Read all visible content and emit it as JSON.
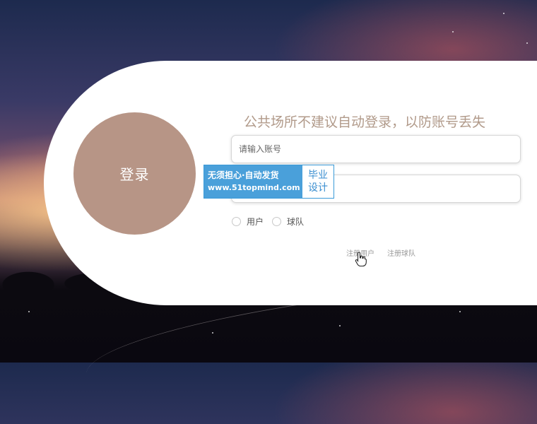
{
  "login": {
    "circle_label": "登录",
    "notice": "公共场所不建议自动登录，以防账号丢失",
    "username_placeholder": "请输入账号",
    "password_placeholder": "",
    "roles": [
      {
        "label": "用户"
      },
      {
        "label": "球队"
      }
    ],
    "links": {
      "register_user": "注册用户",
      "register_team": "注册球队"
    }
  },
  "watermark": {
    "line1": "无须担心·自动发货",
    "line2": "www.51topmind.com",
    "badge_line1": "毕业",
    "badge_line2": "设计"
  },
  "colors": {
    "circle": "#b79586",
    "notice": "#b19a8a",
    "watermark_blue": "#4aa0da"
  }
}
